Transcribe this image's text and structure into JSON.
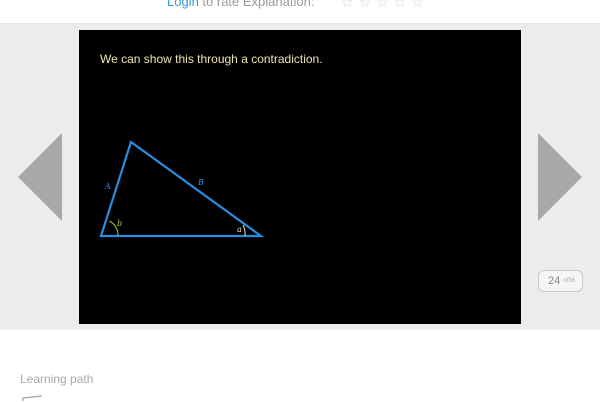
{
  "rating": {
    "login_label": "Login",
    "rest_label": " to rate Explanation:",
    "stars": "☆☆☆☆☆"
  },
  "slide": {
    "caption": "We can show this through a contradiction.",
    "vertex_labels": {
      "side_a": "A",
      "side_b": "B",
      "angle_b": "b",
      "angle_a": "a"
    },
    "colors": {
      "background": "#000000",
      "caption": "#f0e3b0",
      "triangle": "#2a8de0",
      "angle_b_arc": "#9ecf3a",
      "angle_a_arc": "#f0e3b0"
    }
  },
  "navigation": {
    "prev_icon": "chevron-left-icon",
    "next_icon": "chevron-right-icon"
  },
  "counter": {
    "value": "24",
    "suffix": "of36"
  },
  "footer": {
    "learning_path_label": "Learning path",
    "icon": "path-icon"
  }
}
